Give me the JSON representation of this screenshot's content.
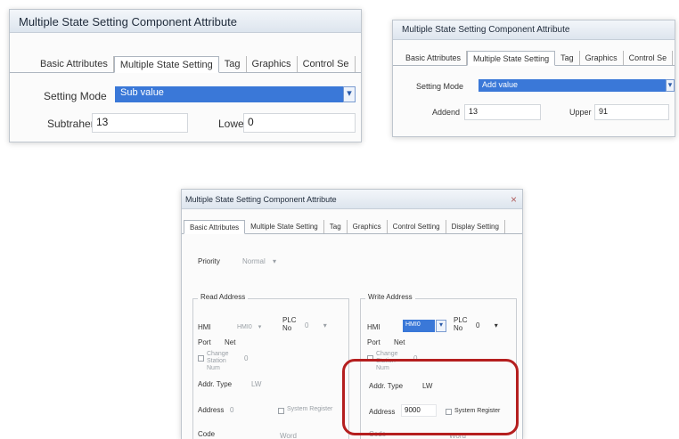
{
  "window_sub": {
    "title": "Multiple State Setting Component Attribute",
    "tabs": [
      "Basic Attributes",
      "Multiple State Setting",
      "Tag",
      "Graphics",
      "Control Se"
    ],
    "setting_mode_label": "Setting Mode",
    "setting_mode_value": "Sub value",
    "field1_label": "Subtrahend",
    "field1_value": "13",
    "field2_label": "Lower",
    "field2_value": "0"
  },
  "window_add": {
    "title": "Multiple State Setting Component Attribute",
    "tabs": [
      "Basic Attributes",
      "Multiple State Setting",
      "Tag",
      "Graphics",
      "Control Se"
    ],
    "setting_mode_label": "Setting Mode",
    "setting_mode_value": "Add value",
    "field1_label": "Addend",
    "field1_value": "13",
    "field2_label": "Upper",
    "field2_value": "91"
  },
  "window_basic": {
    "title": "Multiple State Setting Component Attribute",
    "tabs": [
      "Basic Attributes",
      "Multiple State Setting",
      "Tag",
      "Graphics",
      "Control Setting",
      "Display Setting"
    ],
    "priority_label": "Priority",
    "priority_value": "Normal",
    "read_address": {
      "title": "Read Address",
      "hmi_label": "HMI",
      "hmi_value": "HMI0",
      "plc_no_label": "PLC No",
      "plc_no_value": "0",
      "port_label": "Port",
      "port_value": "Net",
      "change_station_label": "Change Station Num",
      "change_station_value": "0",
      "addr_type_label": "Addr. Type",
      "addr_type_value": "LW",
      "address_label": "Address",
      "address_value": "0",
      "system_register_label": "System Register",
      "code_label": "Code",
      "word_label": "Word"
    },
    "write_address": {
      "title": "Write Address",
      "hmi_label": "HMI",
      "hmi_value": "HMI0",
      "plc_no_label": "PLC No",
      "plc_no_value": "0",
      "port_label": "Port",
      "port_value": "Net",
      "change_station_label": "Change Station Num",
      "change_station_value": "0",
      "addr_type_label": "Addr. Type",
      "addr_type_value": "LW",
      "address_label": "Address",
      "address_value": "9000",
      "system_register_label": "System Register",
      "code_label": "Code",
      "word_label": "Word"
    }
  },
  "icons": {
    "dropdown_arrow": "▾",
    "close": "×"
  },
  "colors": {
    "highlight": "#b51f1f",
    "selection": "#3a78d8"
  }
}
